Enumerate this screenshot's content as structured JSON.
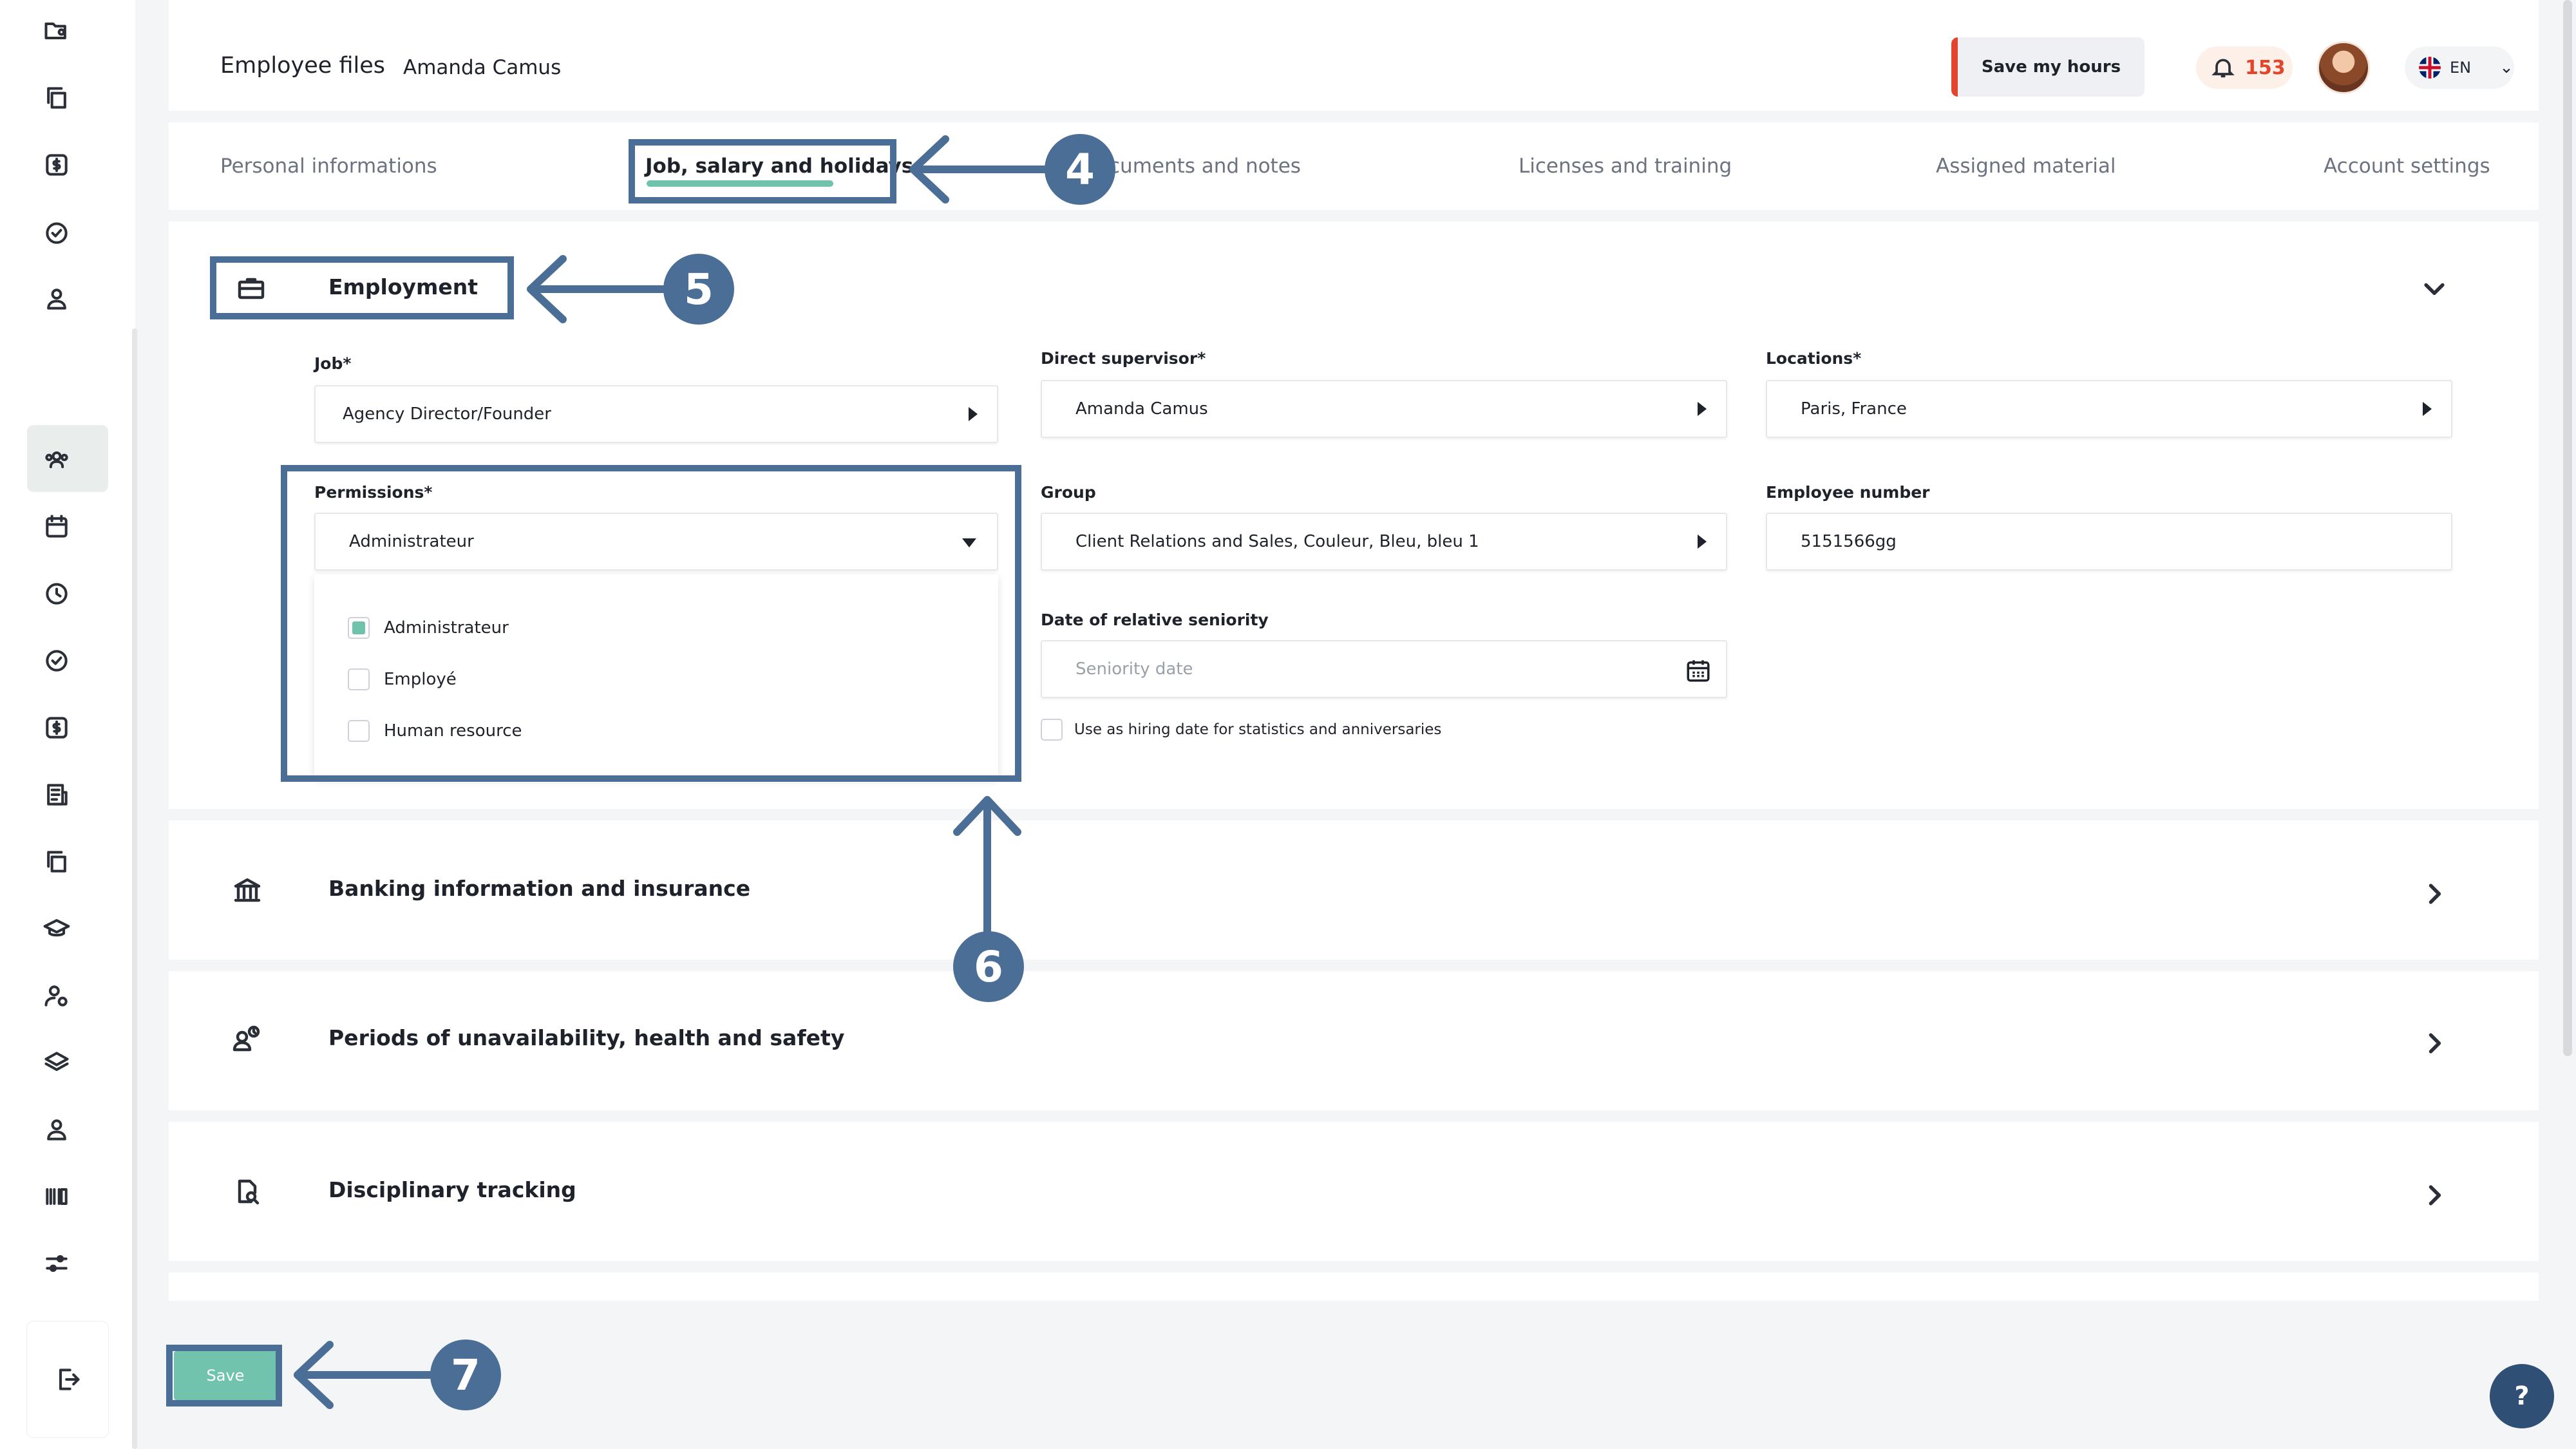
{
  "header": {
    "title": "Employee files",
    "employee_name": "Amanda Camus",
    "save_hours_label": "Save my hours",
    "notification_count": "153",
    "language": "EN"
  },
  "tabs": [
    {
      "label": "Personal informations"
    },
    {
      "label": "Job, salary and holidays"
    },
    {
      "label": "cuments and notes"
    },
    {
      "label": "Licenses and training"
    },
    {
      "label": "Assigned material"
    },
    {
      "label": "Account settings"
    }
  ],
  "employment": {
    "title": "Employment",
    "job_label": "Job*",
    "job_value": "Agency Director/Founder",
    "supervisor_label": "Direct supervisor*",
    "supervisor_value": "Amanda Camus",
    "locations_label": "Locations*",
    "locations_value": "Paris, France",
    "permissions_label": "Permissions*",
    "permissions_value": "Administrateur",
    "permission_options": [
      {
        "label": "Administrateur",
        "checked": true
      },
      {
        "label": "Employé",
        "checked": false
      },
      {
        "label": "Human resource",
        "checked": false
      }
    ],
    "group_label": "Group",
    "group_value": "Client Relations and Sales, Couleur, Bleu, bleu 1",
    "employee_number_label": "Employee number",
    "employee_number_value": "5151566gg",
    "seniority_label": "Date of relative seniority",
    "seniority_placeholder": "Seniority date",
    "hiring_checkbox_label": "Use as hiring date for statistics and anniversaries"
  },
  "sections": {
    "banking": "Banking information and insurance",
    "unavailability": "Periods of unavailability, health and safety",
    "disciplinary": "Disciplinary tracking"
  },
  "footer": {
    "save_label": "Save",
    "help_label": "?"
  },
  "annotations": {
    "step4": "4",
    "step5": "5",
    "step6": "6",
    "step7": "7"
  },
  "colors": {
    "accent": "#6fc3ad",
    "annotation": "#4b6e97",
    "alert": "#e2452c"
  }
}
